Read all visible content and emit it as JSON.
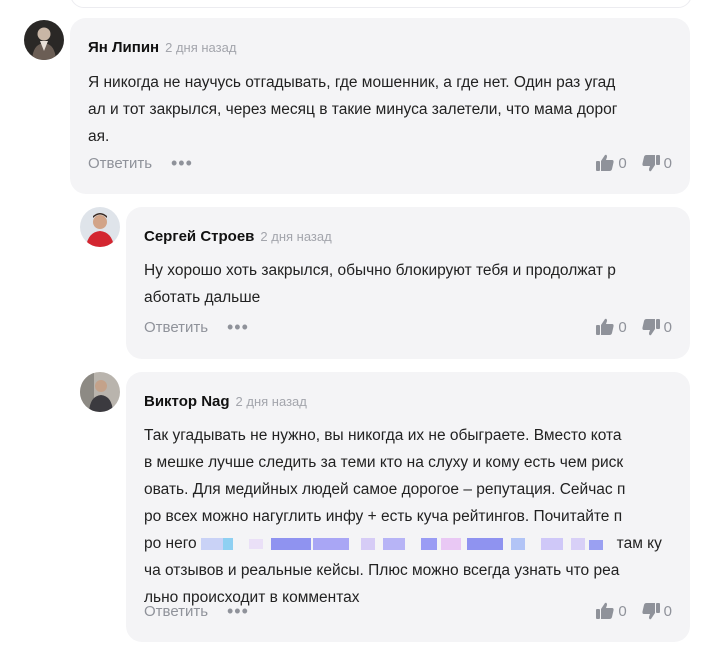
{
  "colors": {
    "card_bg": "#f4f4f6",
    "meta": "#a3a5ac",
    "action": "#8f929a",
    "blur_blue": "#8f93f0",
    "blur_pink": "#e9c8f4"
  },
  "comments": [
    {
      "author": "Ян Липин",
      "time": "2 дня назад",
      "lines": [
        "Я никогда не научусь отгадывать, где мошенник, а где нет. Один раз угад",
        "ал и тот закрылся, через месяц в такие минуса залетели, что мама дорог",
        "ая."
      ],
      "reply_label": "Ответить",
      "more_icon": "ellipsis-icon",
      "likes": "0",
      "dislikes": "0"
    },
    {
      "author": "Сергей Строев",
      "time": "2 дня назад",
      "lines": [
        "Ну хорошо хоть закрылся, обычно блокируют тебя и продолжат р",
        "аботать дальше"
      ],
      "reply_label": "Ответить",
      "more_icon": "ellipsis-icon",
      "likes": "0",
      "dislikes": "0"
    },
    {
      "author": "Виктор Nag",
      "time": "2 дня назад",
      "lines": [
        "Так угадывать не нужно, вы никогда их не обыграете. Вместо кота",
        "в мешке лучше следить за теми кто на слуху и кому есть чем риск",
        "овать. Для медийных людей самое дорогое – репутация. Сейчас п",
        "ро всех можно нагуглить инфу + есть куча рейтингов. Почитайте п"
      ],
      "line5_start": "ро него",
      "line5_end": "там ку",
      "lines_after": [
        "ча отзывов и реальные кейсы. Плюс можно всегда узнать что реа",
        "льно происходит в комментах"
      ],
      "reply_label": "Ответить",
      "more_icon": "ellipsis-icon",
      "likes": "0",
      "dislikes": "0"
    }
  ]
}
